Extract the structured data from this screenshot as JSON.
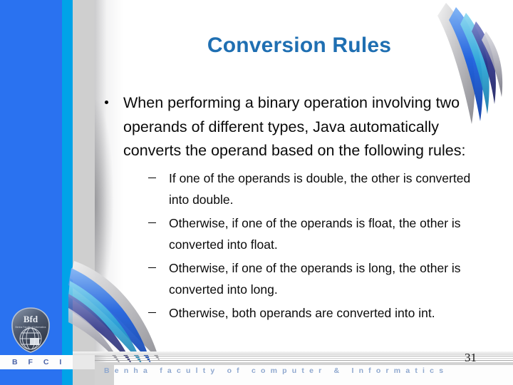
{
  "slide": {
    "title": "Conversion Rules",
    "page_number": "31",
    "title_color": "#1F6FB2",
    "accent_blue": "#2A72F0",
    "accent_cyan": "#00A3E8",
    "accent_gray": "#CFCFCF",
    "body": {
      "bullets": [
        {
          "text": "When performing a binary operation involving two operands of different types, Java automatically converts the operand based on the following rules:",
          "subbullets": [
            "If one of the operands is double, the other is converted into double.",
            "Otherwise, if one of the operands is float, the other is converted into float.",
            "Otherwise, if one of the operands is long, the other is converted into long.",
            "Otherwise, both operands are converted into int."
          ]
        }
      ]
    },
    "footer": {
      "text": "Benha faculty of computer & Informatics",
      "text_color": "#8FA8CF"
    },
    "logo": {
      "monogram": "Bfd",
      "caption": "B F C I",
      "caption_color": "#4A63A8"
    },
    "decor": {
      "swoosh_top_right": "feather-swoosh",
      "swoosh_bottom_left": "feather-swoosh-mirrored"
    }
  }
}
